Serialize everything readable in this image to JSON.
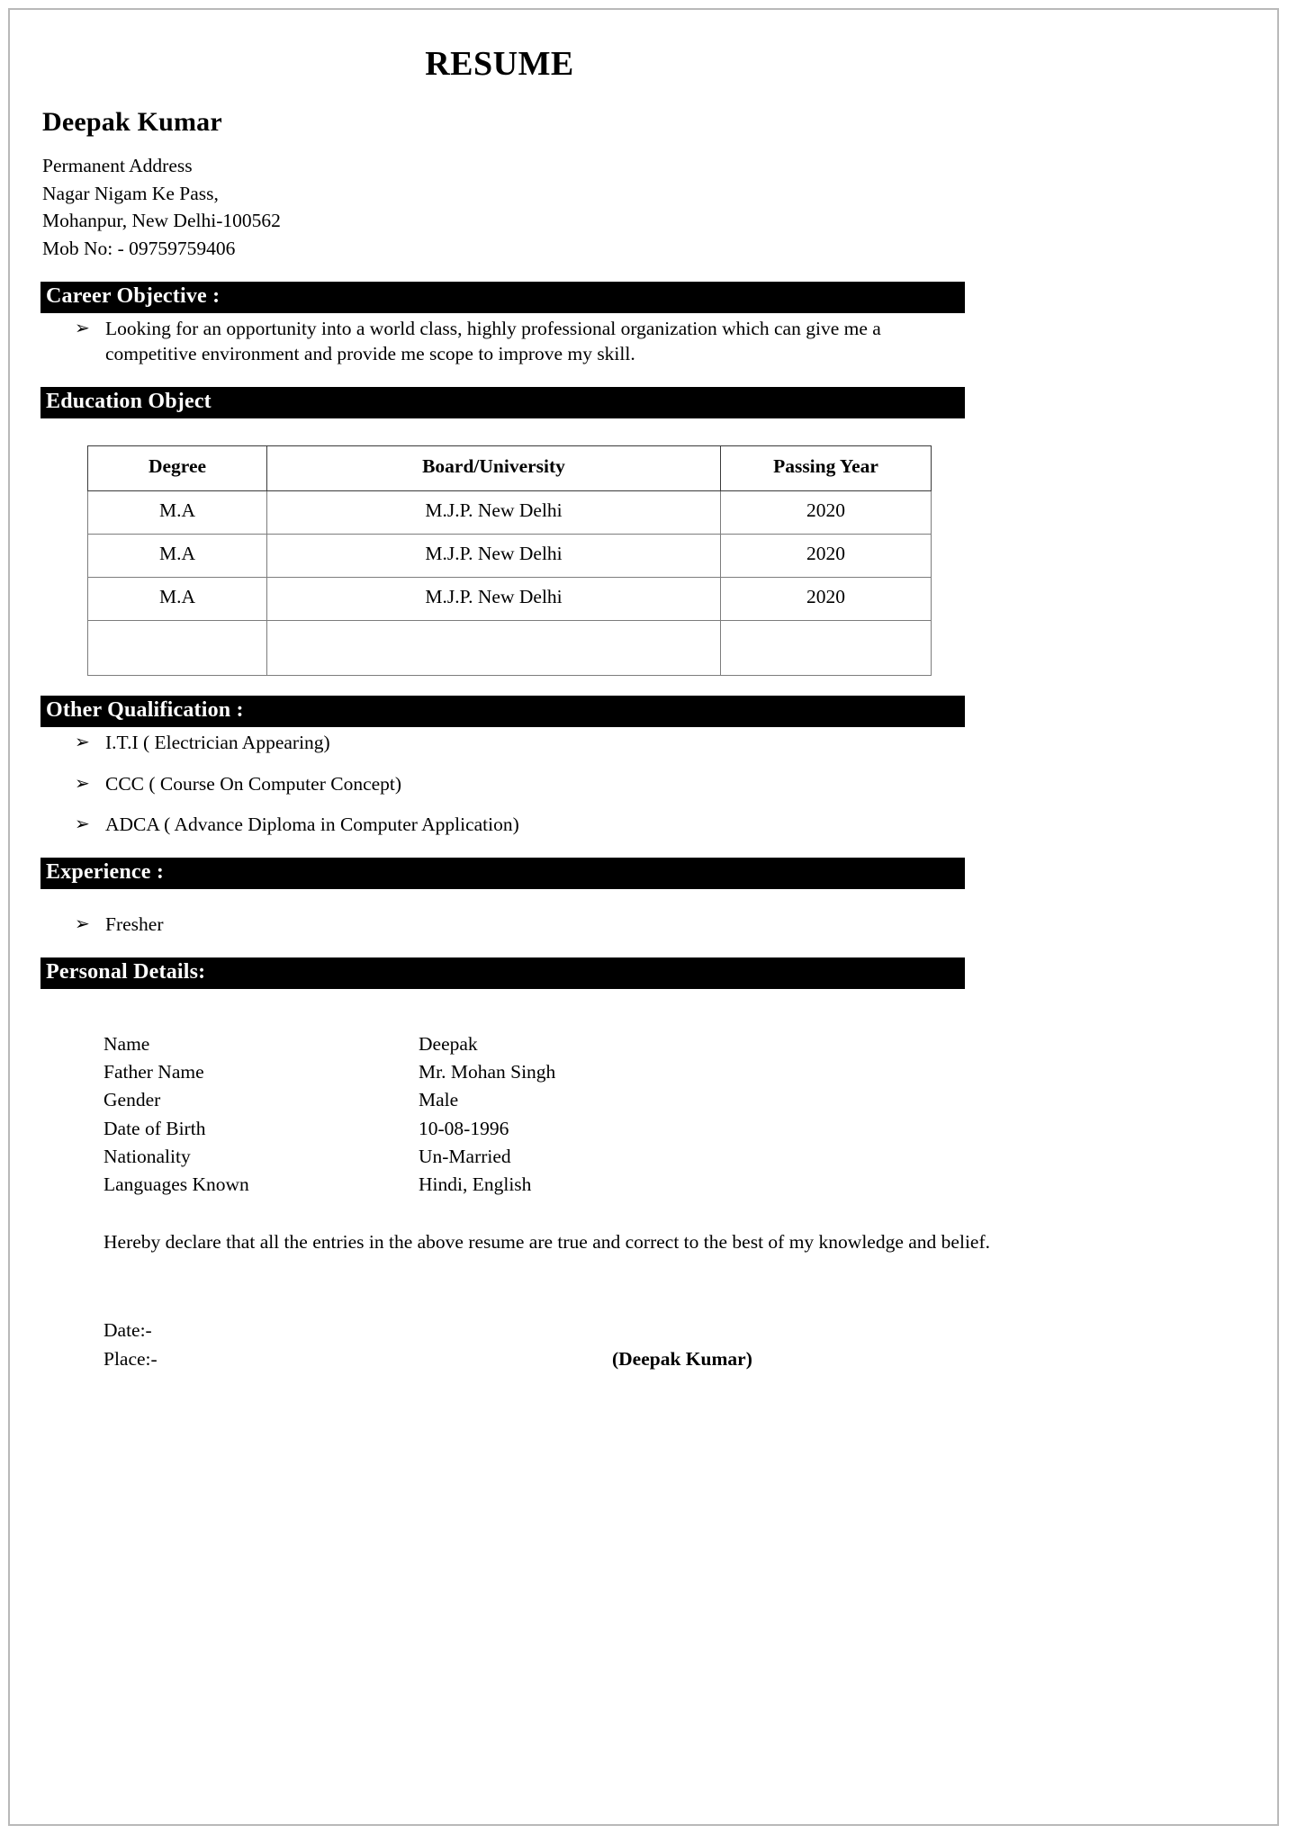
{
  "document": {
    "title": "RESUME",
    "candidate_name": "Deepak Kumar"
  },
  "contact": {
    "address_label": "Permanent Address",
    "address_line1": "Nagar Nigam Ke Pass,",
    "address_line2": "Mohanpur, New Delhi-100562",
    "mobile": "Mob No: - 09759759406"
  },
  "career_objective": {
    "heading": "Career Objective :",
    "bullet_glyph": "➢",
    "text": "Looking for an opportunity into a world class, highly professional organization which can give me a competitive environment and provide me scope to improve my skill."
  },
  "education": {
    "heading": "Education Object",
    "columns": [
      "Degree",
      "Board/University",
      "Passing Year"
    ],
    "rows": [
      [
        "M.A",
        "M.J.P. New Delhi",
        "2020"
      ],
      [
        "M.A",
        "M.J.P. New Delhi",
        "2020"
      ],
      [
        "M.A",
        "M.J.P. New Delhi",
        "2020"
      ],
      [
        "",
        "",
        ""
      ]
    ]
  },
  "other_qualification": {
    "heading": "Other Qualification :",
    "items": [
      "I.T.I  ( Electrician Appearing)",
      "CCC ( Course On Computer Concept)",
      "ADCA ( Advance Diploma in Computer Application)"
    ]
  },
  "experience": {
    "heading": "Experience :",
    "items": [
      "Fresher"
    ]
  },
  "personal_details": {
    "heading": "Personal Details:",
    "rows": [
      {
        "label": "Name",
        "value": "Deepak"
      },
      {
        "label": "Father Name",
        "value": "Mr. Mohan Singh"
      },
      {
        "label": "Gender",
        "value": "Male"
      },
      {
        "label": "Date of Birth",
        "value": "10-08-1996"
      },
      {
        "label": "Nationality",
        "value": "Un-Married"
      },
      {
        "label": "Languages Known",
        "value": "Hindi, English"
      }
    ]
  },
  "declaration": {
    "text": "Hereby declare that all the entries in the above resume are true and correct to the best of my knowledge and belief."
  },
  "closing": {
    "date_label": "Date:-",
    "place_label": "Place:-",
    "signature": "(Deepak Kumar)"
  },
  "colors": {
    "section_bar_bg": "#000000",
    "section_bar_text": "#ffffff",
    "page_border": "#b9b9b9",
    "table_border": "#7d7d7d",
    "text": "#000000"
  }
}
